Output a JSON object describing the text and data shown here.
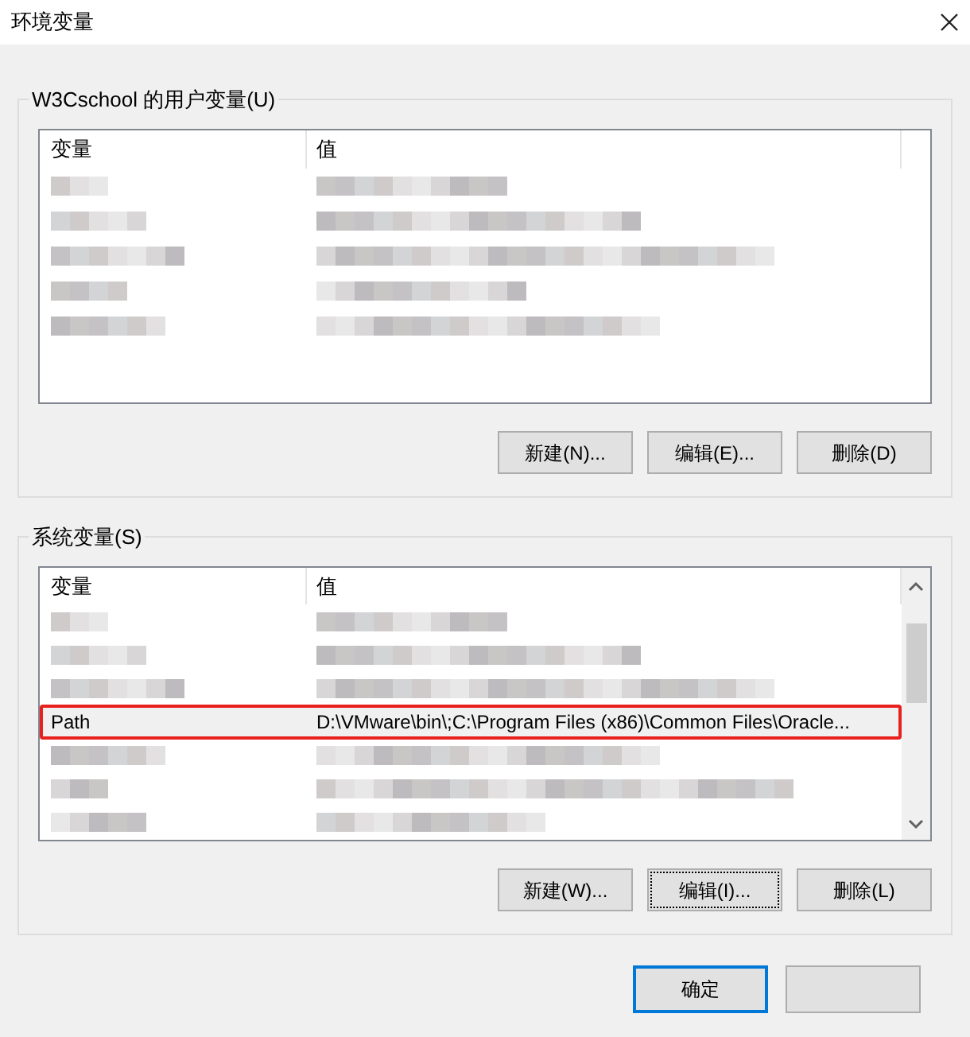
{
  "window": {
    "title": "环境变量"
  },
  "user_variables": {
    "label": "W3Cschool 的用户变量(U)",
    "columns": [
      "变量",
      "值"
    ],
    "rows": [
      {
        "kind": "redacted"
      },
      {
        "kind": "redacted"
      },
      {
        "kind": "redacted"
      },
      {
        "kind": "redacted"
      },
      {
        "kind": "redacted"
      }
    ],
    "buttons": [
      {
        "label": "新建(N)...",
        "focused": false
      },
      {
        "label": "编辑(E)...",
        "focused": false
      },
      {
        "label": "删除(D)",
        "focused": false
      }
    ]
  },
  "system_variables": {
    "label": "系统变量(S)",
    "columns": [
      "变量",
      "值"
    ],
    "rows": [
      {
        "kind": "redacted"
      },
      {
        "kind": "redacted"
      },
      {
        "kind": "redacted"
      },
      {
        "kind": "text",
        "name": "Path",
        "value": "D:\\VMware\\bin\\;C:\\Program Files (x86)\\Common Files\\Oracle...",
        "selected": true,
        "highlighted": true
      },
      {
        "kind": "redacted"
      },
      {
        "kind": "redacted"
      },
      {
        "kind": "redacted"
      }
    ],
    "buttons": [
      {
        "label": "新建(W)...",
        "focused": false
      },
      {
        "label": "编辑(I)...",
        "focused": true
      },
      {
        "label": "删除(L)",
        "focused": false
      }
    ]
  },
  "footer_buttons": [
    {
      "label": "确定",
      "default": true
    },
    {
      "default": false
    }
  ]
}
